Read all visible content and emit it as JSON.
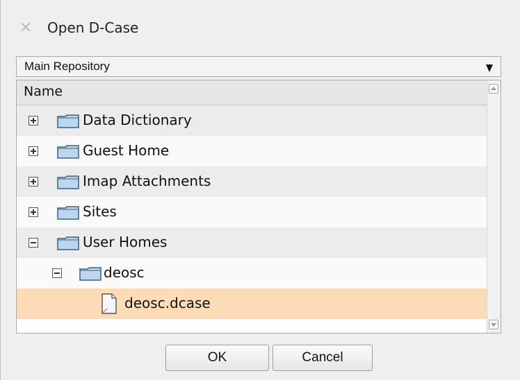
{
  "dialog": {
    "title": "Open D-Case",
    "close_icon": "close-icon"
  },
  "repository_select": {
    "selected": "Main Repository",
    "icon": "dropdown-arrow-icon"
  },
  "tree": {
    "header": "Name",
    "rows": [
      {
        "label": "Data Dictionary",
        "type": "folder",
        "expander": "plus",
        "depth": 0,
        "selected": false
      },
      {
        "label": "Guest Home",
        "type": "folder",
        "expander": "plus",
        "depth": 0,
        "selected": false
      },
      {
        "label": "Imap Attachments",
        "type": "folder",
        "expander": "plus",
        "depth": 0,
        "selected": false
      },
      {
        "label": "Sites",
        "type": "folder",
        "expander": "plus",
        "depth": 0,
        "selected": false
      },
      {
        "label": "User Homes",
        "type": "folder",
        "expander": "minus",
        "depth": 0,
        "selected": false
      },
      {
        "label": "deosc",
        "type": "folder",
        "expander": "minus",
        "depth": 1,
        "selected": false
      },
      {
        "label": "deosc.dcase",
        "type": "file",
        "expander": null,
        "depth": 2,
        "selected": true
      }
    ]
  },
  "buttons": {
    "ok": "OK",
    "cancel": "Cancel"
  },
  "colors": {
    "selection": "#fbdcb6",
    "folder_fill": "#bcd6ee",
    "folder_stroke": "#3f5f80"
  }
}
